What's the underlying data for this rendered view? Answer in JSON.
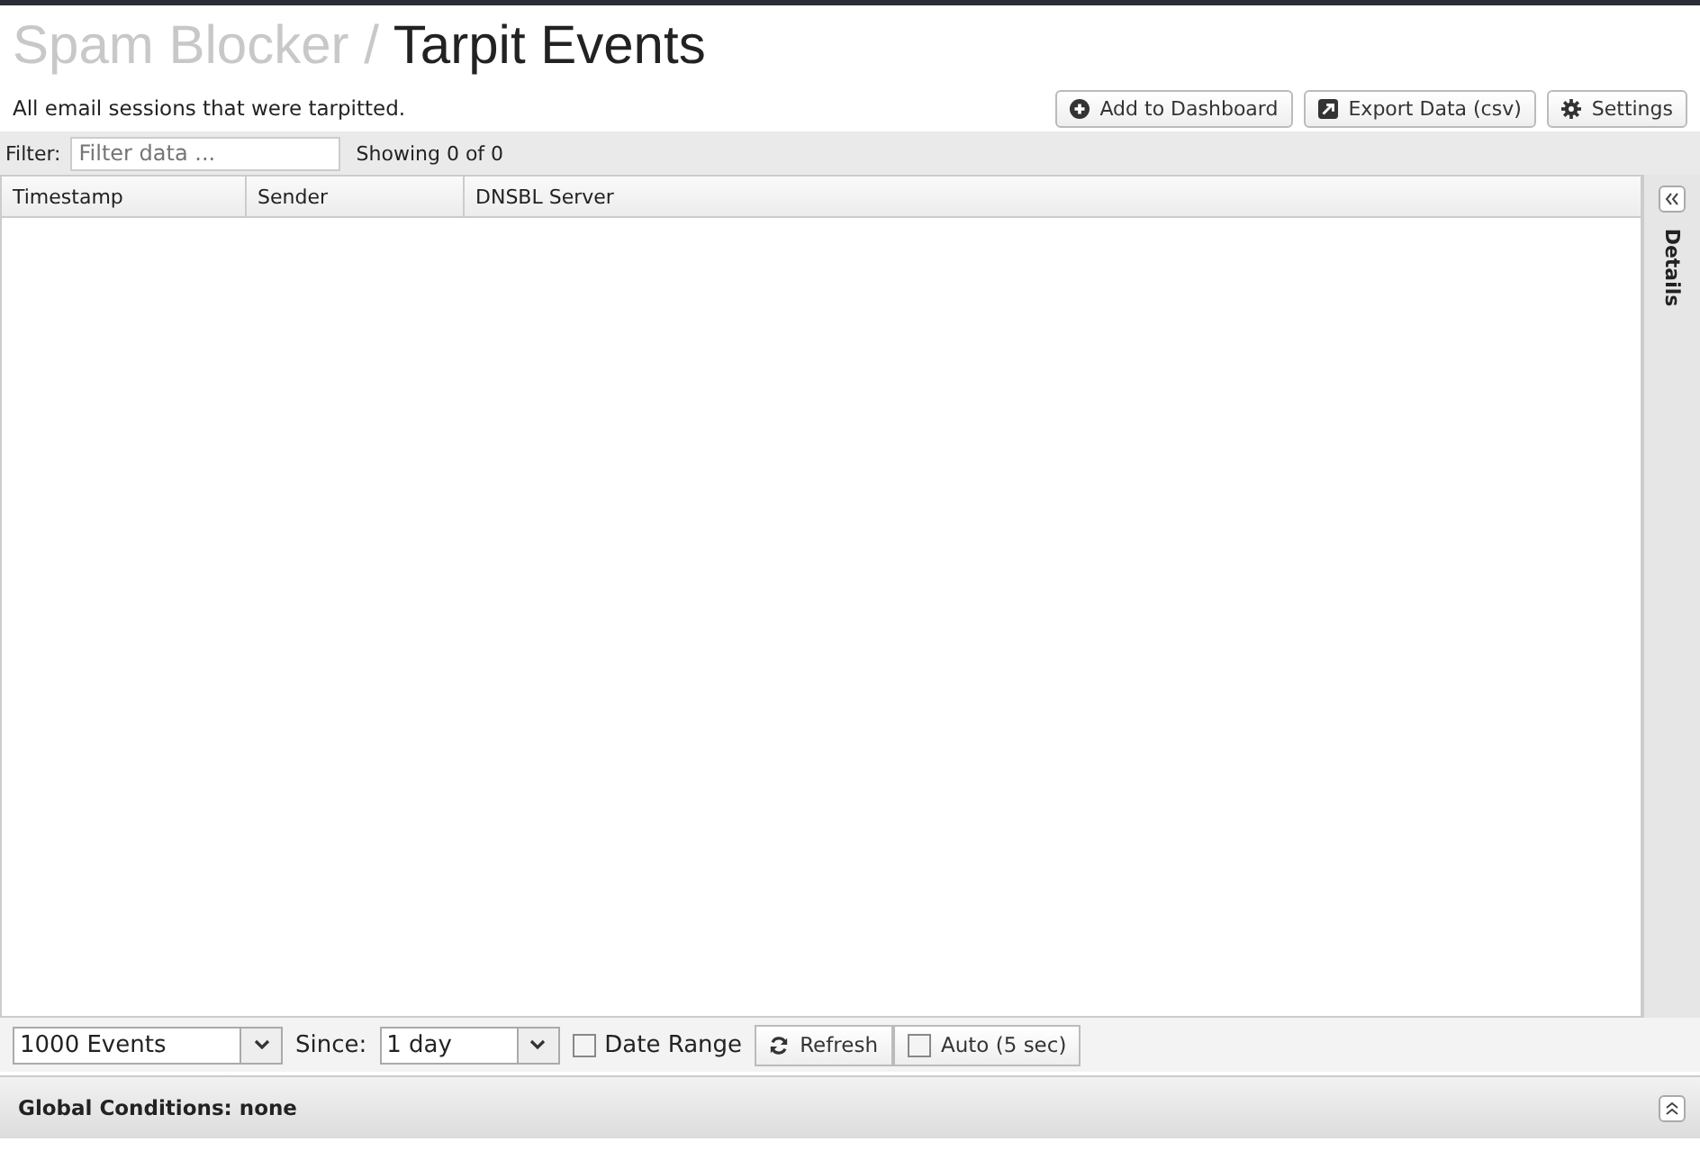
{
  "header": {
    "breadcrumb": "Spam Blocker /",
    "title": "Tarpit Events",
    "description": "All email sessions that were tarpitted."
  },
  "buttons": [
    {
      "label": "Add to Dashboard",
      "kind": "add"
    },
    {
      "label": "Export Data (csv)",
      "kind": "export"
    },
    {
      "label": "Settings",
      "kind": "settings"
    }
  ],
  "filter": {
    "label": "Filter:",
    "placeholder": "Filter data ...",
    "count": "Showing 0 of 0"
  },
  "table": {
    "columns": [
      "Timestamp",
      "Sender",
      "DNSBL Server"
    ]
  },
  "details_panel": {
    "label": "Details"
  },
  "toolbar": {
    "limit": "1000 Events",
    "since_label": "Since:",
    "since": "1 day",
    "date_range": {
      "label": "Date Range",
      "checked": false
    },
    "refresh": "Refresh",
    "auto": {
      "label": "Auto (5 sec)",
      "checked": false
    }
  },
  "global_conditions": "Global Conditions: none"
}
